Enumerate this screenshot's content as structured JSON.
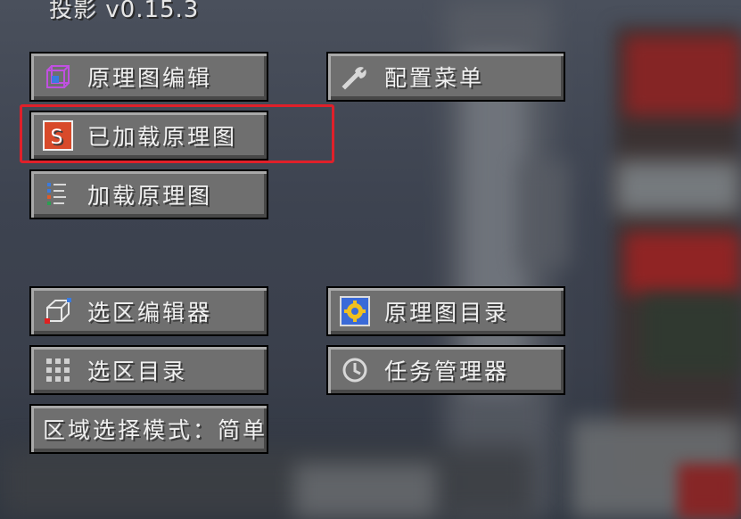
{
  "title": "投影 v0.15.3",
  "buttons": {
    "schematic_editor": "原理图编辑",
    "config_menu": "配置菜单",
    "loaded_schematics": "已加载原理图",
    "load_schematics": "加载原理图",
    "area_editor": "选区编辑器",
    "schematic_browser": "原理图目录",
    "area_browser": "选区目录",
    "task_manager": "任务管理器",
    "area_selection_mode": "区域选择模式：简单"
  },
  "icons": {
    "schematic_editor": "schematic-cube-icon",
    "config_menu": "wrench-icon",
    "loaded_schematics": "schematic-s-icon",
    "load_schematics": "list-icon",
    "area_editor": "area-cube-icon",
    "schematic_browser": "gear-badge-icon",
    "area_browser": "grid-icon",
    "task_manager": "clock-icon"
  },
  "colors": {
    "highlight": "#e0202a",
    "button_face": "#6f6f6f",
    "button_text": "#f0f0f0"
  }
}
